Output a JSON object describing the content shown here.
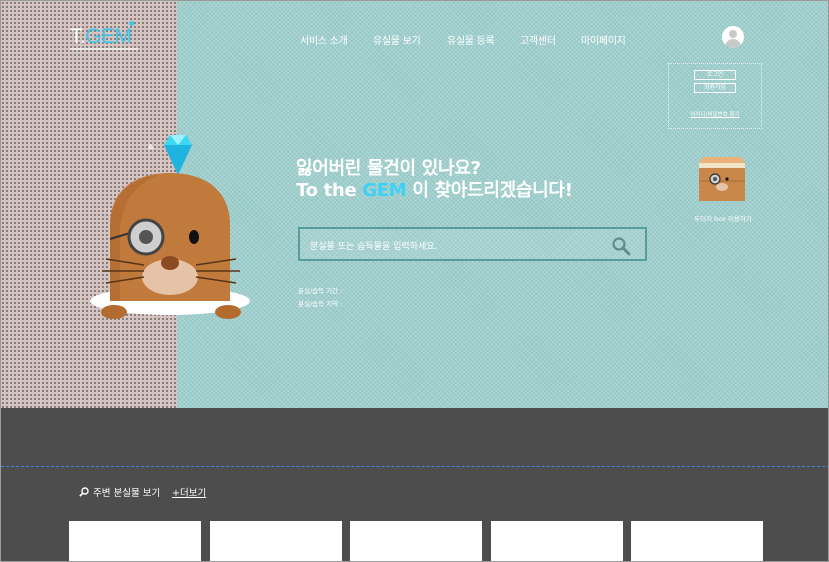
{
  "logo": {
    "t": "T.",
    "gem": "GEM"
  },
  "nav": {
    "items": [
      {
        "label": "서비스 소개"
      },
      {
        "label": "유실물 보기"
      },
      {
        "label": "유실물 등록"
      },
      {
        "label": "고객센터"
      },
      {
        "label": "마이페이지"
      }
    ]
  },
  "account": {
    "login": "로그인",
    "signup": "회원가입",
    "find_link": "아이디/비밀번호 찾기"
  },
  "hero": {
    "line1": "잃어버린 물건이 있나요?",
    "line2_pre": "To the ",
    "line2_brand": "GEM",
    "line2_post": " 이 찾아드리겠습니다!",
    "search_placeholder": "분실물 또는 습득물을 입력하세요.",
    "meta1": "분실/습득 기간 :",
    "meta2": "분실/습득 지역 :"
  },
  "box": {
    "caption": "두더지 box 이용하기"
  },
  "nearby": {
    "title": "주변 분실물 보기",
    "more": "+더보기"
  },
  "colors": {
    "brand": "#39c6ea",
    "hero_bg": "#9ecfcd",
    "side_bg": "#d6c2bf",
    "dark_bg": "#4d4d4d"
  },
  "icons": [
    "search-icon",
    "user-icon",
    "box-icon",
    "diamond-icon",
    "mole-mascot"
  ]
}
